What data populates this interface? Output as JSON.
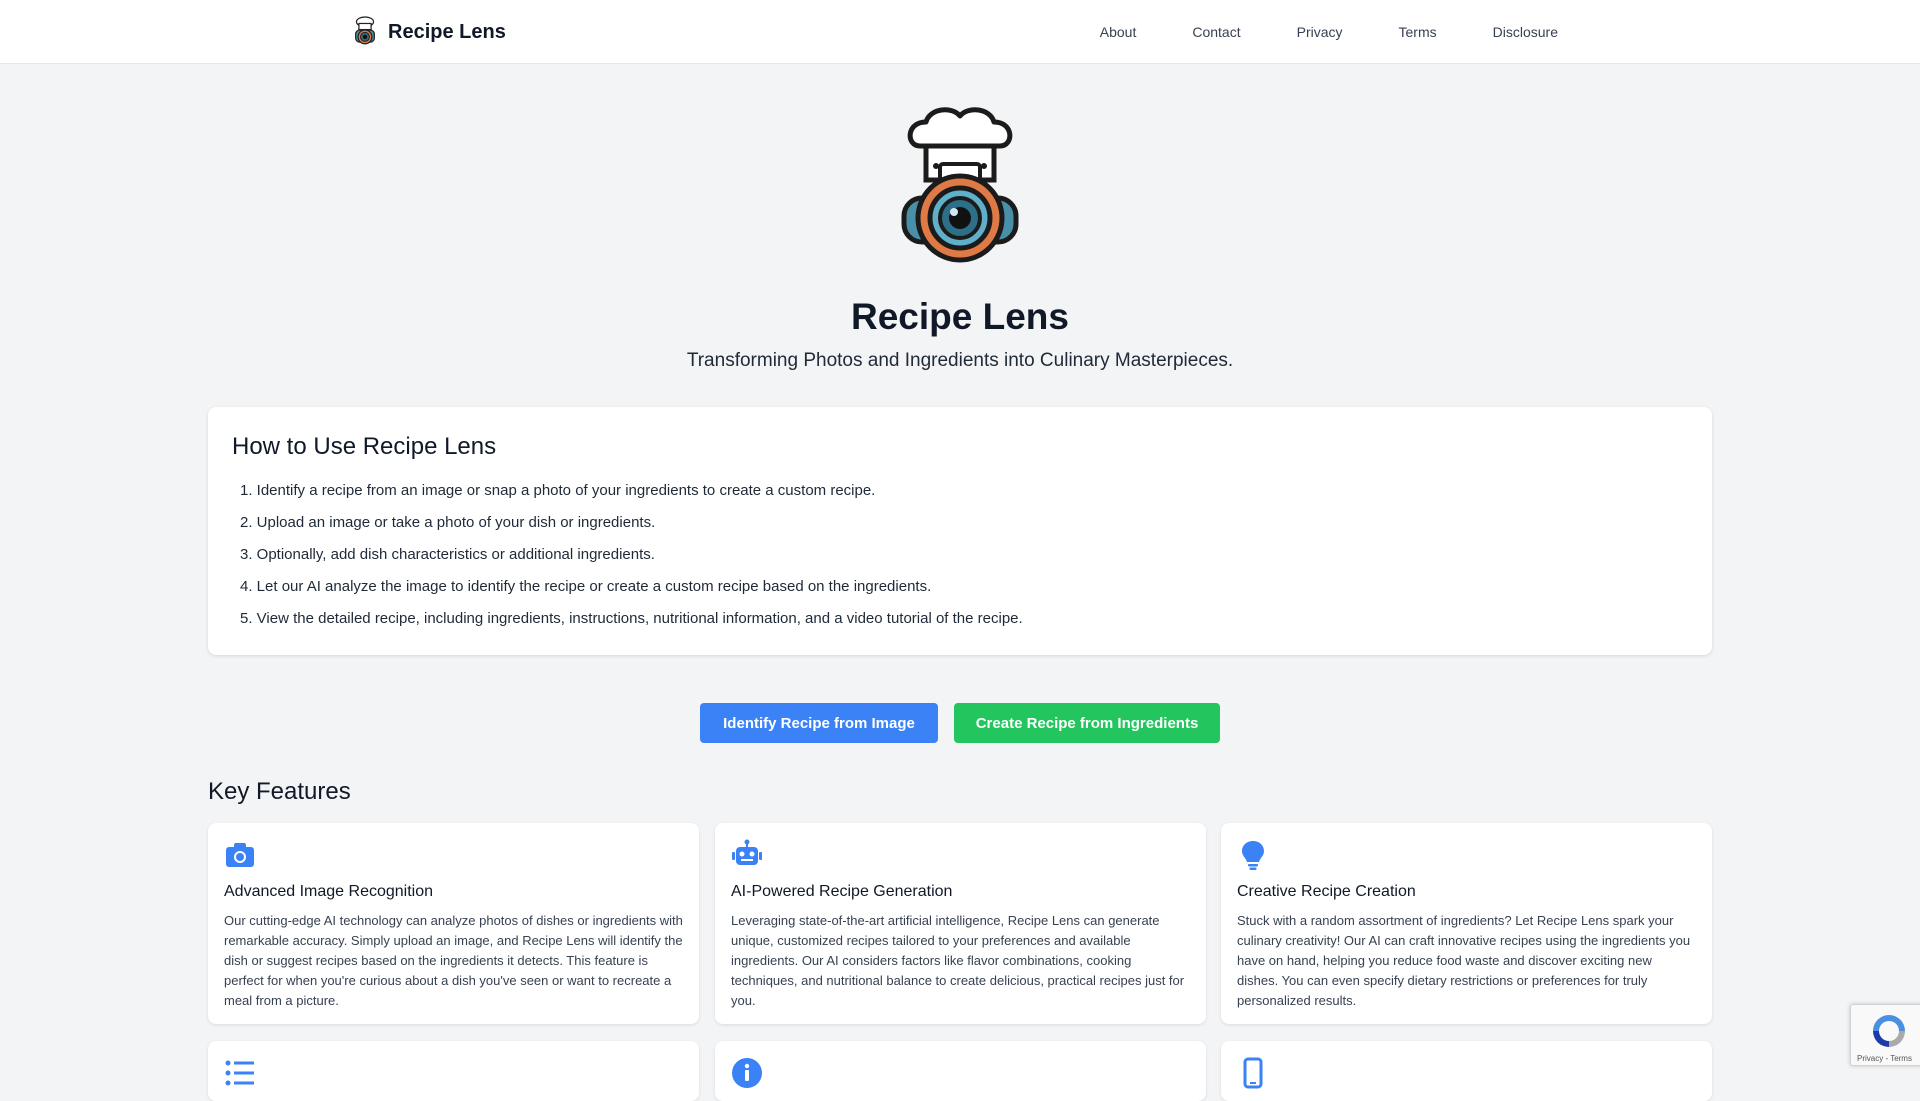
{
  "header": {
    "brand": "Recipe Lens",
    "nav": [
      "About",
      "Contact",
      "Privacy",
      "Terms",
      "Disclosure"
    ]
  },
  "hero": {
    "title": "Recipe Lens",
    "tagline": "Transforming Photos and Ingredients into Culinary Masterpieces."
  },
  "howto": {
    "title": "How to Use Recipe Lens",
    "steps": [
      "1. Identify a recipe from an image or snap a photo of your ingredients to create a custom recipe.",
      "2. Upload an image or take a photo of your dish or ingredients.",
      "3. Optionally, add dish characteristics or additional ingredients.",
      "4. Let our AI analyze the image to identify the recipe or create a custom recipe based on the ingredients.",
      "5. View the detailed recipe, including ingredients, instructions, nutritional information, and a video tutorial of the recipe."
    ]
  },
  "buttons": {
    "identify": "Identify Recipe from Image",
    "create": "Create Recipe from Ingredients"
  },
  "features": {
    "title": "Key Features",
    "items": [
      {
        "icon": "camera-icon",
        "title": "Advanced Image Recognition",
        "text": "Our cutting-edge AI technology can analyze photos of dishes or ingredients with remarkable accuracy. Simply upload an image, and Recipe Lens will identify the dish or suggest recipes based on the ingredients it detects. This feature is perfect for when you're curious about a dish you've seen or want to recreate a meal from a picture."
      },
      {
        "icon": "robot-icon",
        "title": "AI-Powered Recipe Generation",
        "text": "Leveraging state-of-the-art artificial intelligence, Recipe Lens can generate unique, customized recipes tailored to your preferences and available ingredients. Our AI considers factors like flavor combinations, cooking techniques, and nutritional balance to create delicious, practical recipes just for you."
      },
      {
        "icon": "lightbulb-icon",
        "title": "Creative Recipe Creation",
        "text": "Stuck with a random assortment of ingredients? Let Recipe Lens spark your culinary creativity! Our AI can craft innovative recipes using the ingredients you have on hand, helping you reduce food waste and discover exciting new dishes. You can even specify dietary restrictions or preferences for truly personalized results."
      },
      {
        "icon": "list-icon"
      },
      {
        "icon": "info-icon"
      },
      {
        "icon": "mobile-icon"
      }
    ]
  },
  "recaptcha": {
    "text": "Privacy - Terms"
  },
  "colors": {
    "primary_blue": "#3b82f6",
    "primary_green": "#22c55e",
    "icon_blue": "#3b82f6",
    "background": "#f3f4f6"
  }
}
